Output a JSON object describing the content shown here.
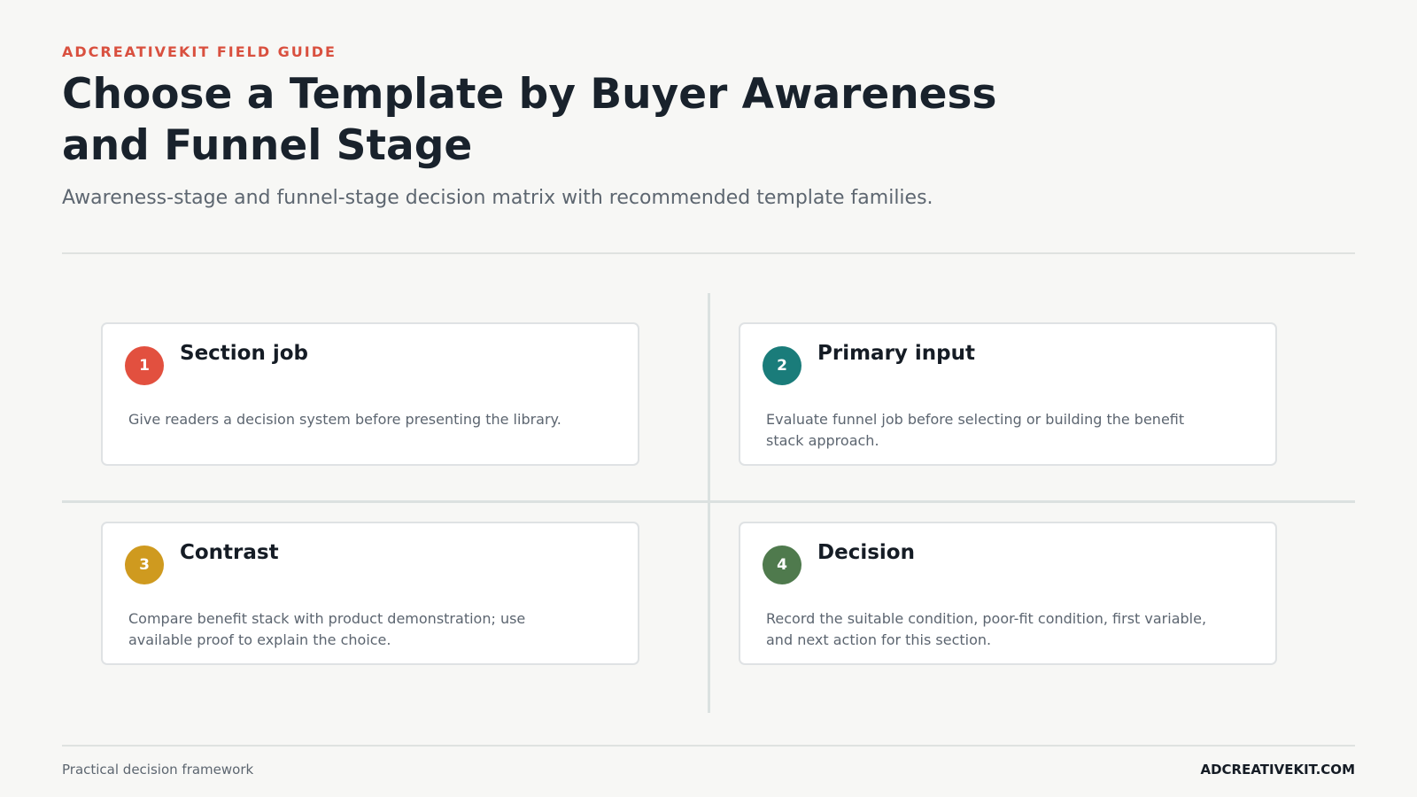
{
  "header": {
    "eyebrow": "ADCREATIVEKIT FIELD GUIDE",
    "title": "Choose a Template by Buyer Awareness and Funnel Stage",
    "subtitle": "Awareness-stage and funnel-stage decision matrix with recommended template families."
  },
  "cards": [
    {
      "number": "1",
      "title": "Section job",
      "body": "Give readers a decision system before presenting the library.",
      "color": "#e2503f"
    },
    {
      "number": "2",
      "title": "Primary input",
      "body": "Evaluate funnel job before selecting or building the benefit stack approach.",
      "color": "#1a7c7a"
    },
    {
      "number": "3",
      "title": "Contrast",
      "body": "Compare benefit stack with product demonstration; use available proof to explain the choice.",
      "color": "#cf9a1f"
    },
    {
      "number": "4",
      "title": "Decision",
      "body": "Record the suitable condition, poor-fit condition, first variable, and next action for this section.",
      "color": "#4f7a4d"
    }
  ],
  "footer": {
    "left": "Practical decision framework",
    "right": "ADCREATIVEKIT.COM"
  }
}
